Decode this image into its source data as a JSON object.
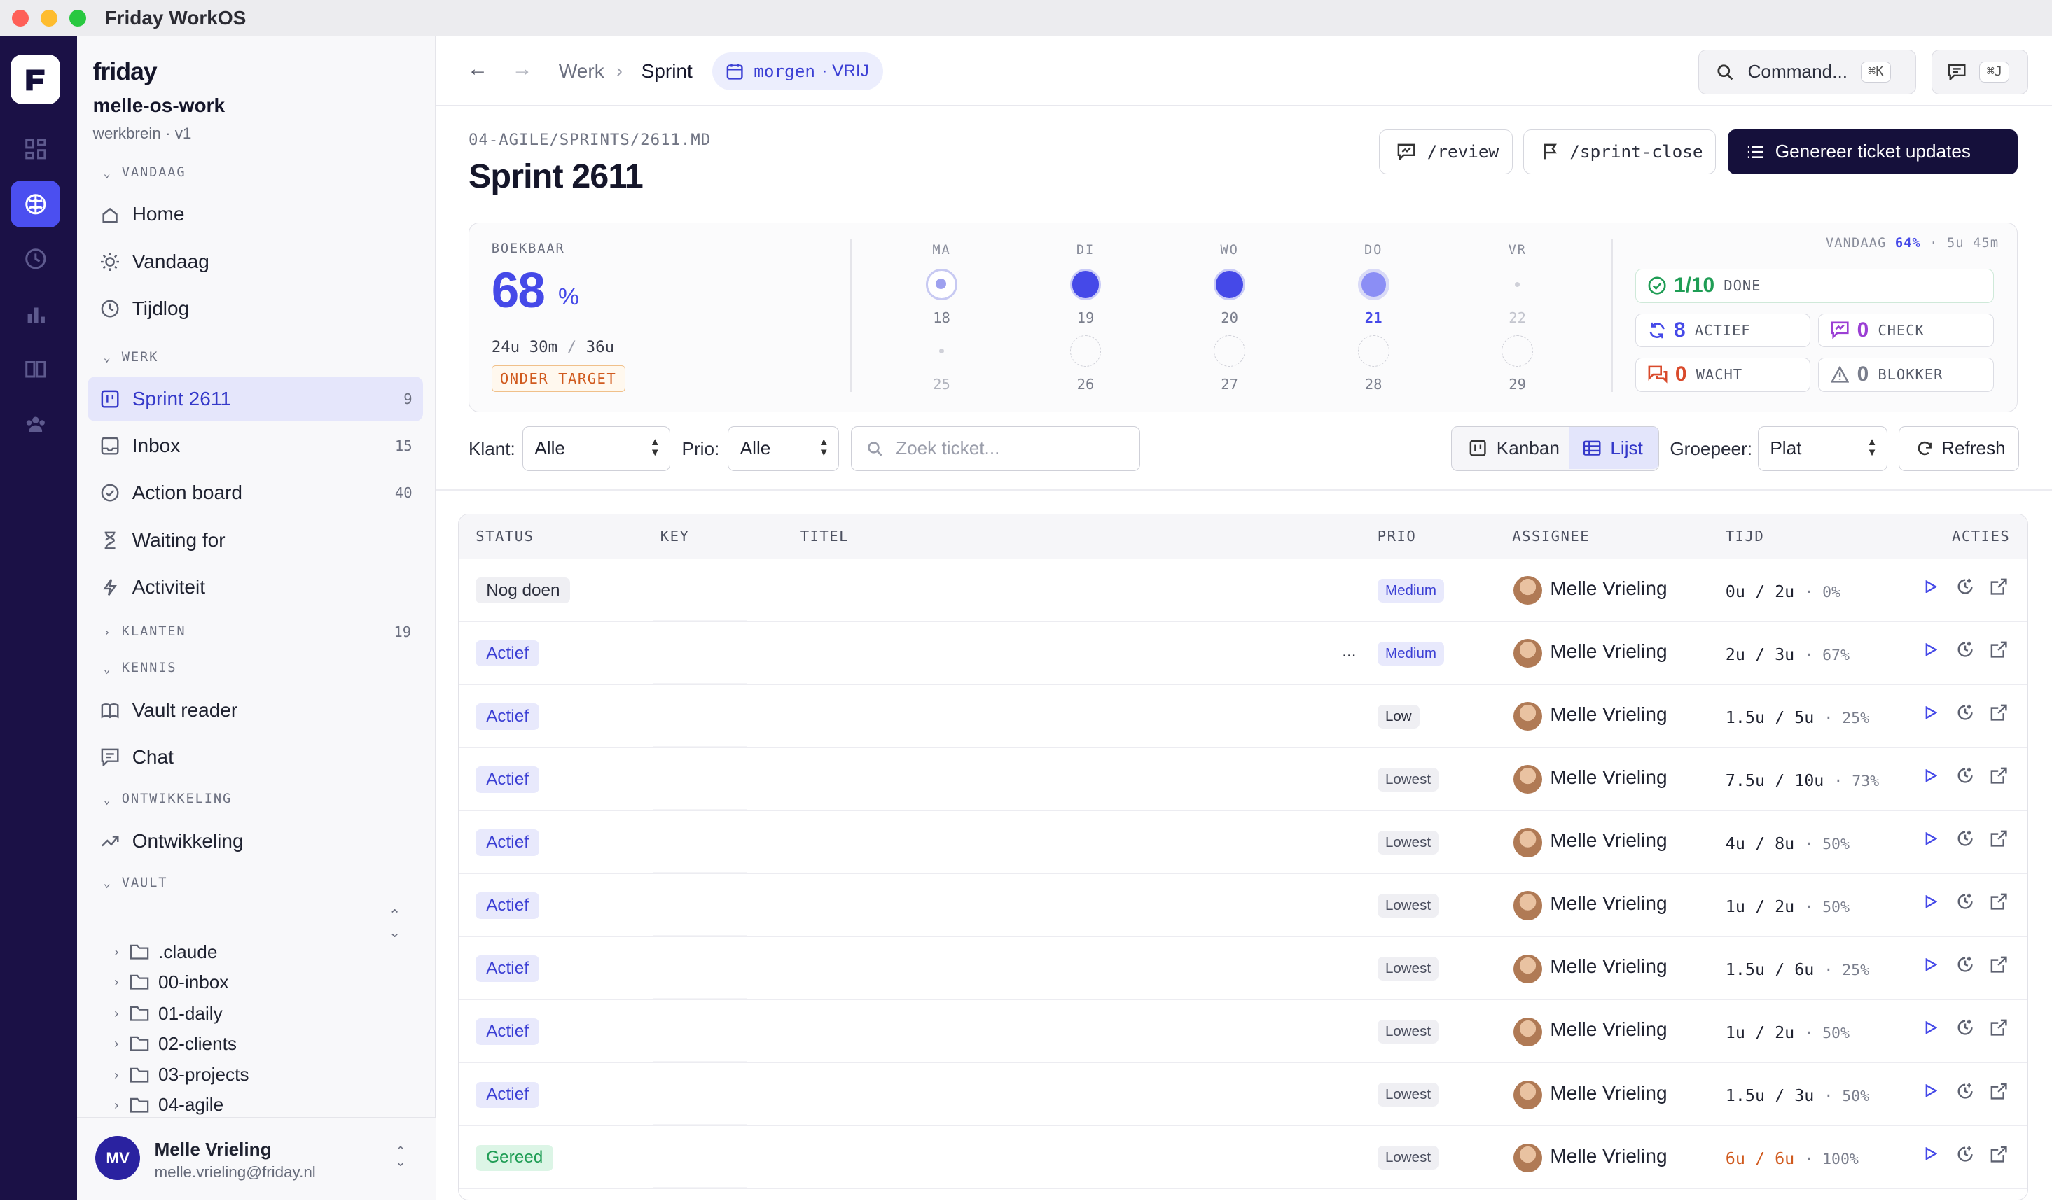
{
  "window": {
    "title": "Friday WorkOS"
  },
  "rail": {
    "icons": [
      "app-logo-icon",
      "grid-icon",
      "brain-icon",
      "clock-icon",
      "bar-chart-icon",
      "book-icon",
      "team-icon"
    ]
  },
  "sidebar": {
    "brand": "friday",
    "workspace": "melle-os-work",
    "workspace_sub": "werkbrein · v1",
    "sections": {
      "vandaag": "VANDAAG",
      "werk": "WERK",
      "klanten": "KLANTEN",
      "klanten_count": "19",
      "kennis": "KENNIS",
      "ontwikkeling": "ONTWIKKELING",
      "vault": "VAULT"
    },
    "items": {
      "home": "Home",
      "vandaag": "Vandaag",
      "tijdlog": "Tijdlog",
      "sprint": "Sprint 2611",
      "sprint_count": "9",
      "inbox": "Inbox",
      "inbox_count": "15",
      "action_board": "Action board",
      "action_board_count": "40",
      "waiting": "Waiting for",
      "activiteit": "Activiteit",
      "vault_reader": "Vault reader",
      "chat": "Chat",
      "ontwikkeling": "Ontwikkeling"
    },
    "tree": [
      ".claude",
      "00-inbox",
      "01-daily",
      "02-clients",
      "03-projects",
      "04-agile"
    ],
    "user": {
      "initials": "MV",
      "name": "Melle Vrieling",
      "email": "melle.vrieling@friday.nl"
    }
  },
  "topbar": {
    "crumb_werk": "Werk",
    "crumb_sprint": "Sprint",
    "date_pill_day": "morgen",
    "date_pill_status": "· VRIJ",
    "command_label": "Command...",
    "command_kbd": "⌘K",
    "chat_kbd": "⌘J"
  },
  "page": {
    "path": "04-AGILE/SPRINTS/2611.MD",
    "title": "Sprint 2611",
    "review_label": "/review",
    "sprint_close_label": "/sprint-close",
    "generate_label": "Genereer ticket updates"
  },
  "stats": {
    "boekbaar_label": "BOEKBAAR",
    "boekbaar_value": "68",
    "boekbaar_unit": "%",
    "hours": "24u 30m",
    "hours_sep": "/",
    "hours_total": "36u",
    "target_label": "ONDER TARGET",
    "days": [
      {
        "label": "MA",
        "w1": "18",
        "w2": "25",
        "state1": "light",
        "state2": "dot"
      },
      {
        "label": "DI",
        "w1": "19",
        "w2": "26",
        "state1": "full",
        "state2": "empty"
      },
      {
        "label": "WO",
        "w1": "20",
        "w2": "27",
        "state1": "full",
        "state2": "empty"
      },
      {
        "label": "DO",
        "w1": "21",
        "w2": "28",
        "state1": "today",
        "state2": "empty"
      },
      {
        "label": "VR",
        "w1": "22",
        "w2": "29",
        "state1": "dot",
        "state2": "empty"
      }
    ],
    "vandaag_label": "VANDAAG",
    "vandaag_pct": "64%",
    "vandaag_time": "· 5u 45m",
    "done_value": "1/10",
    "done_label": "DONE",
    "actief_value": "8",
    "actief_label": "ACTIEF",
    "check_value": "0",
    "check_label": "CHECK",
    "wacht_value": "0",
    "wacht_label": "WACHT",
    "blokker_value": "0",
    "blokker_label": "BLOKKER"
  },
  "filters": {
    "klant_label": "Klant:",
    "klant_value": "Alle",
    "prio_label": "Prio:",
    "prio_value": "Alle",
    "search_placeholder": "Zoek ticket...",
    "kanban_label": "Kanban",
    "lijst_label": "Lijst",
    "groepeer_label": "Groepeer:",
    "groepeer_value": "Plat",
    "refresh_label": "Refresh"
  },
  "table": {
    "headers": {
      "status": "STATUS",
      "key": "KEY",
      "titel": "TITEL",
      "prio": "PRIO",
      "assignee": "ASSIGNEE",
      "tijd": "TIJD",
      "acties": "ACTIES"
    },
    "rows": [
      {
        "status": "Nog doen",
        "status_kind": "todo",
        "title": "",
        "prio": "Medium",
        "assignee": "Melle Vrieling",
        "spent": "0u",
        "est": "2u",
        "pct": "0%"
      },
      {
        "status": "Actief",
        "status_kind": "active",
        "title": "...",
        "prio": "Medium",
        "assignee": "Melle Vrieling",
        "spent": "2u",
        "est": "3u",
        "pct": "67%"
      },
      {
        "status": "Actief",
        "status_kind": "active",
        "title": "",
        "prio": "Low",
        "assignee": "Melle Vrieling",
        "spent": "1.5u",
        "est": "5u",
        "pct": "25%"
      },
      {
        "status": "Actief",
        "status_kind": "active",
        "title": "",
        "prio": "Lowest",
        "assignee": "Melle Vrieling",
        "spent": "7.5u",
        "est": "10u",
        "pct": "73%"
      },
      {
        "status": "Actief",
        "status_kind": "active",
        "title": "",
        "prio": "Lowest",
        "assignee": "Melle Vrieling",
        "spent": "4u",
        "est": "8u",
        "pct": "50%"
      },
      {
        "status": "Actief",
        "status_kind": "active",
        "title": "",
        "prio": "Lowest",
        "assignee": "Melle Vrieling",
        "spent": "1u",
        "est": "2u",
        "pct": "50%"
      },
      {
        "status": "Actief",
        "status_kind": "active",
        "title": "",
        "prio": "Lowest",
        "assignee": "Melle Vrieling",
        "spent": "1.5u",
        "est": "6u",
        "pct": "25%"
      },
      {
        "status": "Actief",
        "status_kind": "active",
        "title": "",
        "prio": "Lowest",
        "assignee": "Melle Vrieling",
        "spent": "1u",
        "est": "2u",
        "pct": "50%"
      },
      {
        "status": "Actief",
        "status_kind": "active",
        "title": "",
        "prio": "Lowest",
        "assignee": "Melle Vrieling",
        "spent": "1.5u",
        "est": "3u",
        "pct": "50%"
      },
      {
        "status": "Gereed",
        "status_kind": "done",
        "title": "",
        "prio": "Lowest",
        "assignee": "Melle Vrieling",
        "spent": "6u",
        "est": "6u",
        "pct": "100%"
      }
    ]
  },
  "colors": {
    "accent": "#4b4ff0",
    "rail": "#1b1146",
    "dark_button": "#15103b",
    "warn": "#d05a1e",
    "done": "#1f9d55"
  }
}
